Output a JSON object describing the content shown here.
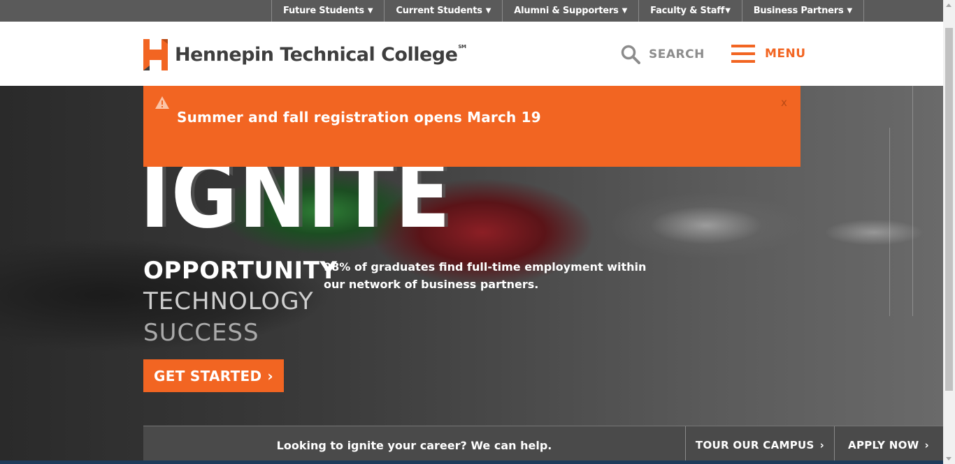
{
  "topnav": {
    "items": [
      {
        "label": "Future Students",
        "caret": "▼"
      },
      {
        "label": "Current Students",
        "caret": "▼"
      },
      {
        "label": "Alumni & Supporters",
        "caret": "▼"
      },
      {
        "label": "Faculty & Staff",
        "caret": "▼"
      },
      {
        "label": "Business Partners",
        "caret": "▼"
      }
    ]
  },
  "header": {
    "logo_text": "Hennepin Technical College",
    "logo_mark_sup": "SM",
    "search_label": "SEARCH",
    "menu_label": "MENU"
  },
  "alert": {
    "message": "Summer and fall registration opens March 19",
    "close_label": "x"
  },
  "hero": {
    "headline": "IGNITE",
    "word1": "OPPORTUNITY",
    "word2": "TECHNOLOGY",
    "word3": "SUCCESS",
    "stat": "98% of graduates find full-time employment within our network of business partners.",
    "cta_label": "GET STARTED",
    "cta_chevron": "›"
  },
  "bottombar": {
    "tagline": "Looking to ignite your career? We can help.",
    "tour_label": "TOUR OUR CAMPUS",
    "apply_label": "APPLY NOW",
    "chevron": "›"
  },
  "colors": {
    "brand_orange": "#f26522",
    "topbar_gray": "#5a5a5a",
    "logo_gray": "#3e3e3e"
  }
}
